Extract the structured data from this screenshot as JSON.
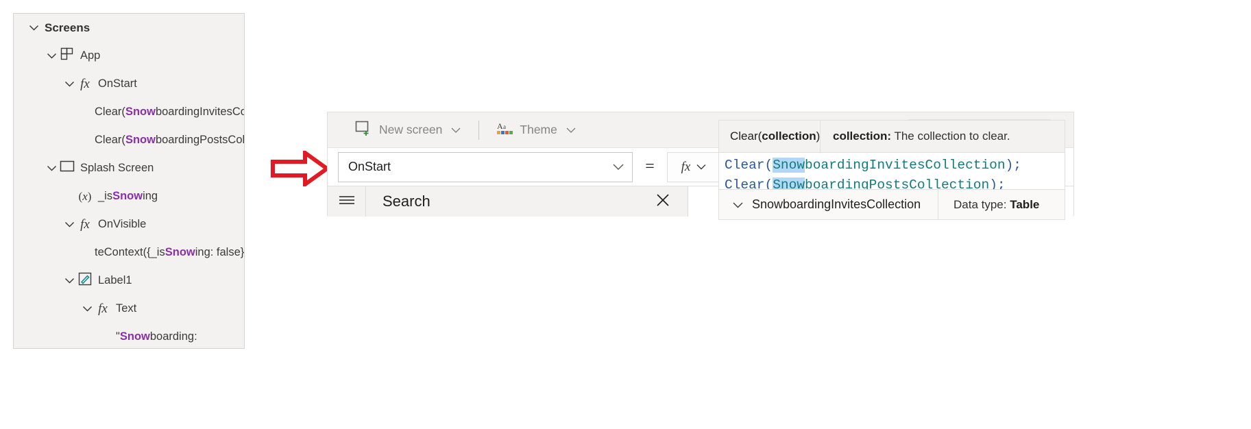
{
  "tree": {
    "items": [
      {
        "indent": 0,
        "chevron": true,
        "icon": "none",
        "label_html": "Screens",
        "bold": true
      },
      {
        "indent": 1,
        "chevron": true,
        "icon": "app-grid",
        "label_html": "App"
      },
      {
        "indent": 2,
        "chevron": true,
        "icon": "fx",
        "label_html": "OnStart"
      },
      {
        "indent": 3,
        "chevron": false,
        "icon": "none",
        "label_html": "Clear(<span class=\"hl\">Snow</span>boardingInvitesColle..."
      },
      {
        "indent": 3,
        "chevron": false,
        "icon": "none",
        "label_html": "Clear(<span class=\"hl\">Snow</span>boardingPostsCollec..."
      },
      {
        "indent": 1,
        "chevron": true,
        "icon": "screen",
        "label_html": "Splash Screen"
      },
      {
        "indent": 2,
        "chevron": false,
        "icon": "variable",
        "label_html": "_is<span class=\"hl\">Snow</span>ing"
      },
      {
        "indent": 2,
        "chevron": true,
        "icon": "fx",
        "label_html": "OnVisible"
      },
      {
        "indent": 3,
        "chevron": false,
        "icon": "none",
        "label_html": "teContext({_is<span class=\"hl\">Snow</span>ing: false});"
      },
      {
        "indent": 2,
        "chevron": true,
        "icon": "label-pencil",
        "label_html": "Label1"
      },
      {
        "indent": 3,
        "chevron": true,
        "icon": "fx",
        "label_html": "Text"
      },
      {
        "indent": 4,
        "chevron": false,
        "icon": "none",
        "label_html": "\"<span class=\"hl\">Snow</span>boarding:"
      }
    ]
  },
  "studio": {
    "ribbon": {
      "new_screen_label": "New screen",
      "theme_label": "Theme",
      "new_screen_icon": "new-screen-icon",
      "theme_icon": "theme-aa-icon",
      "chevron_icon": "chevron-down-icon"
    },
    "formula_bar": {
      "property_value": "OnStart",
      "equals": "=",
      "fx_label": "fx"
    },
    "bottom": {
      "hamburger_icon": "hamburger-icon",
      "search_label": "Search",
      "close_icon": "close-icon"
    }
  },
  "intellisense": {
    "tooltip": {
      "signature_prefix": "Clear(",
      "signature_param": "collection",
      "signature_suffix": ")",
      "desc_param": "collection:",
      "desc_text": "The collection to clear."
    },
    "code_lines": [
      {
        "fn": "Clear",
        "open": "(",
        "selected": "Snow",
        "rest": "boardingInvitesCollection",
        "close": ")",
        "semi": ";"
      },
      {
        "fn": "Clear",
        "open": "(",
        "selected": "Snow",
        "rest": "boardingPostsCollection",
        "close": ")",
        "semi": ";"
      }
    ],
    "suggestion": {
      "name": "SnowboardingInvitesCollection",
      "type_label": "Data type:",
      "type_value": "Table",
      "chevron_icon": "chevron-down-icon"
    }
  }
}
